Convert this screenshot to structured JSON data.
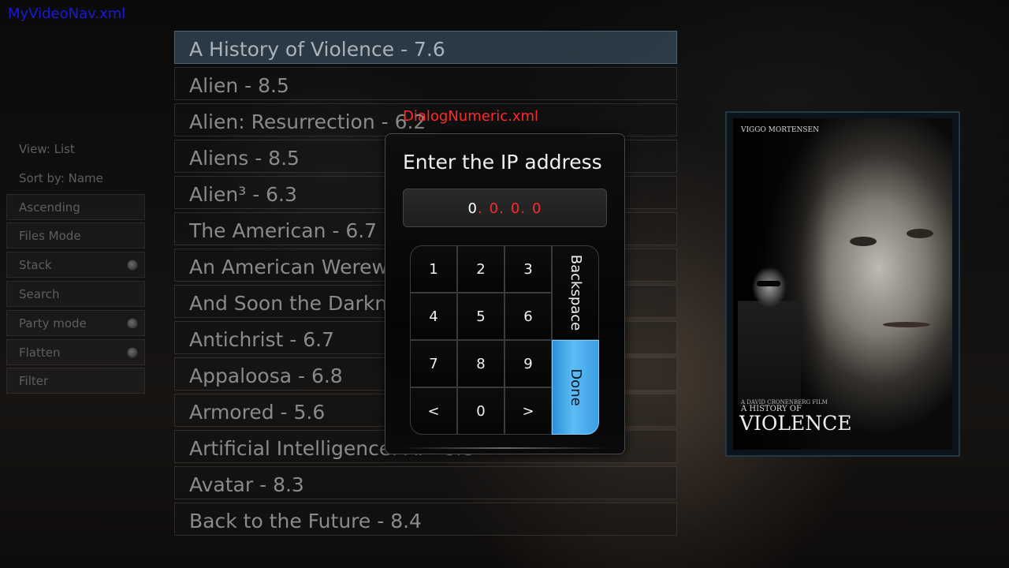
{
  "debug": {
    "nav_window": "MyVideoNav.xml",
    "dialog_window": "DialogNumeric.xml"
  },
  "side_menu": [
    {
      "label": "View: List",
      "plain": true
    },
    {
      "label": "Sort by: Name",
      "plain": true
    },
    {
      "label": "Ascending"
    },
    {
      "label": "Files Mode"
    },
    {
      "label": "Stack",
      "radio": true
    },
    {
      "label": "Search"
    },
    {
      "label": "Party mode",
      "radio": true
    },
    {
      "label": "Flatten",
      "radio": true
    },
    {
      "label": "Filter"
    }
  ],
  "movies": [
    "A History of Violence - 7.6",
    "Alien - 8.5",
    "Alien: Resurrection - 6.2",
    "Aliens - 8.5",
    "Alien³ - 6.3",
    "The American - 6.7",
    "An American Werewolf in London",
    "And Soon the Darkness - 5.2",
    "Antichrist - 6.7",
    "Appaloosa - 6.8",
    "Armored - 5.6",
    "Artificial Intelligence: AI - 6.8",
    "Avatar - 8.3",
    "Back to the Future - 8.4"
  ],
  "focused_movie_index": 0,
  "poster": {
    "actor": "VIGGO MORTENSEN",
    "kicker": "A DAVID CRONENBERG FILM",
    "subtitle": "A HISTORY OF",
    "title": "VIOLENCE"
  },
  "dialog": {
    "heading": "Enter the IP address",
    "ip_octets": [
      "0",
      "0",
      "0",
      "0"
    ],
    "active_octet": 0,
    "keys": {
      "k1": "1",
      "k2": "2",
      "k3": "3",
      "k4": "4",
      "k5": "5",
      "k6": "6",
      "k7": "7",
      "k8": "8",
      "k9": "9",
      "prev": "<",
      "k0": "0",
      "next": ">",
      "backspace": "Backspace",
      "done": "Done"
    }
  }
}
